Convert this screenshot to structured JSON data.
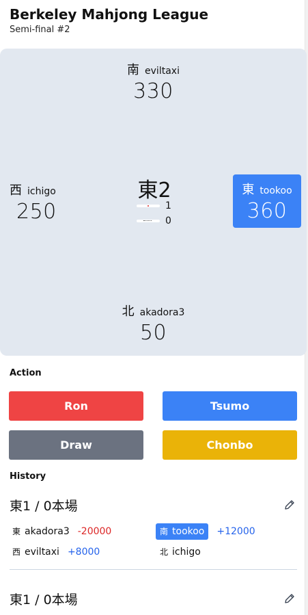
{
  "header": {
    "title": "Berkeley Mahjong League",
    "subtitle": "Semi-final #2"
  },
  "table": {
    "round": "東2",
    "riichi_sticks": "1",
    "honba_sticks": "0",
    "seats": {
      "top": {
        "wind": "南",
        "name": "eviltaxi",
        "score": "330"
      },
      "left": {
        "wind": "西",
        "name": "ichigo",
        "score": "250"
      },
      "right": {
        "wind": "東",
        "name": "tookoo",
        "score": "360",
        "dealer": true
      },
      "bottom": {
        "wind": "北",
        "name": "akadora3",
        "score": "50"
      }
    }
  },
  "actions": {
    "label": "Action",
    "ron": "Ron",
    "tsumo": "Tsumo",
    "draw": "Draw",
    "chonbo": "Chonbo"
  },
  "history": {
    "label": "History",
    "entries": [
      {
        "title": "東1 / 0本場",
        "rows": [
          {
            "wind": "東",
            "name": "akadora3",
            "delta": "-20000"
          },
          {
            "wind": "南",
            "name": "tookoo",
            "delta": "+12000"
          },
          {
            "wind": "西",
            "name": "eviltaxi",
            "delta": "+8000"
          },
          {
            "wind": "北",
            "name": "ichigo",
            "delta": ""
          }
        ]
      },
      {
        "title": "東1 / 0本場"
      }
    ]
  },
  "colors": {
    "table_bg": "#e2e8f0",
    "dealer": "#3b82f6",
    "ron": "#ef4444",
    "tsumo": "#3b82f6",
    "draw": "#6b7280",
    "chonbo": "#eab308",
    "negative": "#dc2626",
    "positive": "#2563eb"
  }
}
